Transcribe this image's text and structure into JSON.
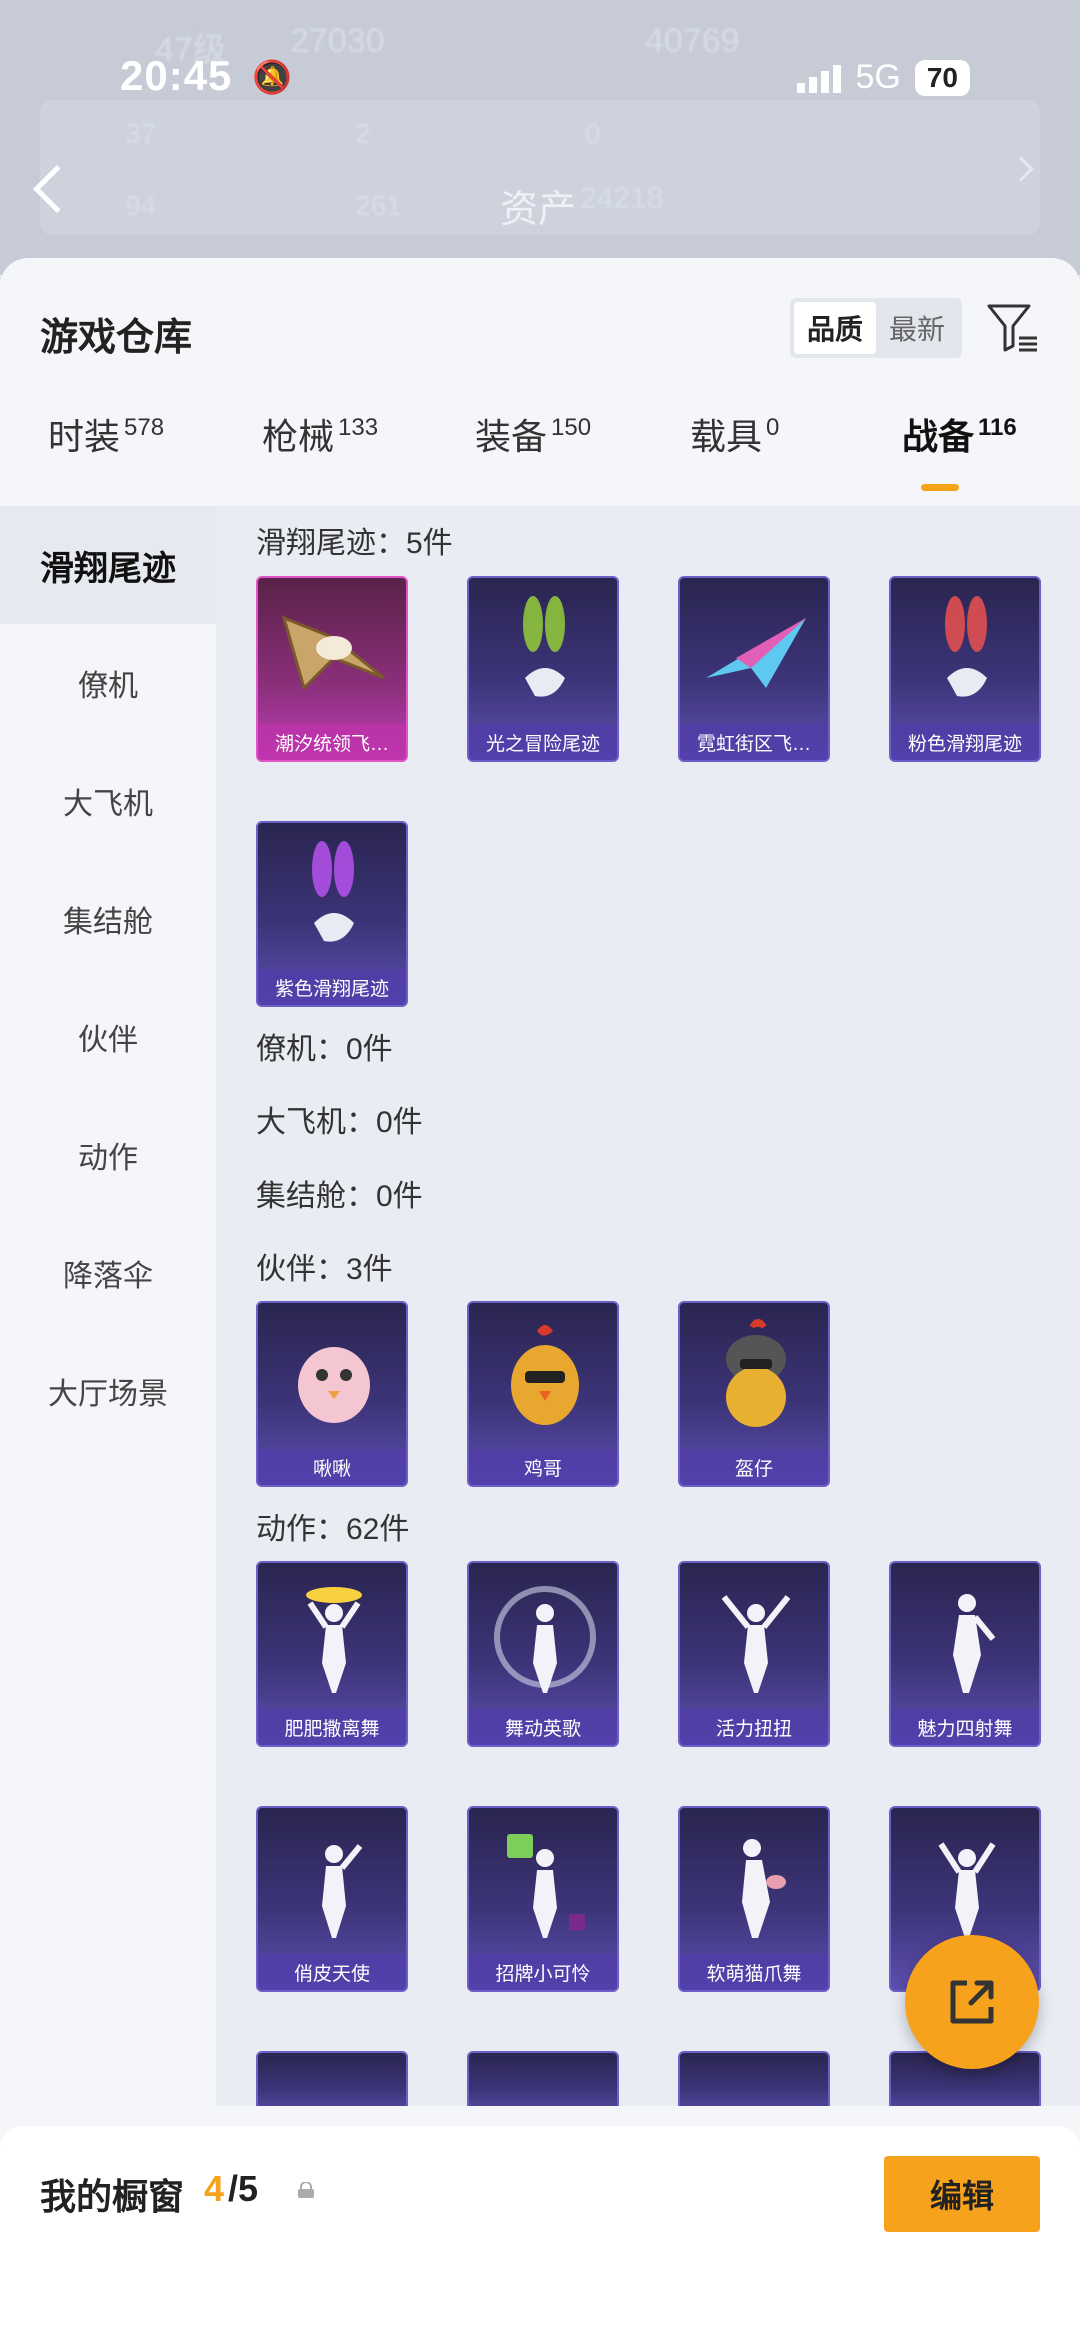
{
  "status_bar": {
    "time": "20:45",
    "network": "5G",
    "battery": "70"
  },
  "header_bg": {
    "level": "47级",
    "coins": "27030",
    "score": "40769",
    "assets_label": "资产",
    "assets_value": "24218",
    "stat_values": [
      "37",
      "2",
      "0",
      "94",
      "261"
    ]
  },
  "sheet": {
    "title": "游戏仓库",
    "sort": {
      "quality": "品质",
      "newest": "最新"
    }
  },
  "tabs": [
    {
      "label": "时装",
      "count": "578"
    },
    {
      "label": "枪械",
      "count": "133"
    },
    {
      "label": "装备",
      "count": "150"
    },
    {
      "label": "载具",
      "count": "0"
    },
    {
      "label": "战备",
      "count": "116"
    }
  ],
  "sidenav": [
    "滑翔尾迹",
    "僚机",
    "大飞机",
    "集结舱",
    "伙伴",
    "动作",
    "降落伞",
    "大厅场景"
  ],
  "sections": {
    "glide": {
      "title": "滑翔尾迹：5件",
      "items": [
        "潮汐统领飞…",
        "光之冒险尾迹",
        "霓虹街区飞…",
        "粉色滑翔尾迹",
        "紫色滑翔尾迹"
      ]
    },
    "wingman": {
      "title": "僚机：0件"
    },
    "plane": {
      "title": "大飞机：0件"
    },
    "pod": {
      "title": "集结舱：0件"
    },
    "partner": {
      "title": "伙伴：3件",
      "items": [
        "啾啾",
        "鸡哥",
        "盔仔"
      ]
    },
    "emote": {
      "title": "动作：62件",
      "items": [
        "肥肥撒离舞",
        "舞动英歌",
        "活力扭扭",
        "魅力四射舞",
        "俏皮天使",
        "招牌小可怜",
        "软萌猫爪舞"
      ]
    }
  },
  "bottom": {
    "showcase_label": "我的橱窗",
    "showcase_count": "4",
    "showcase_total": "/5",
    "edit": "编辑"
  },
  "icons": {
    "filter": "filter-icon",
    "share": "share-icon",
    "lock": "lock-icon",
    "back": "back-arrow-icon"
  },
  "colors": {
    "accent": "#f5a31a",
    "item_bg": "#3c3478",
    "epic_bg": "#8c2f7c"
  }
}
